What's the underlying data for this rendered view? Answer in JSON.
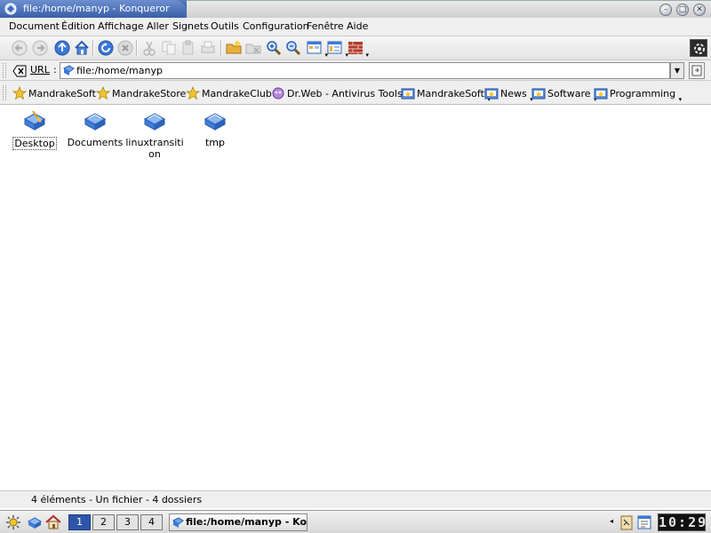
{
  "window": {
    "title": "file:/home/manyp - Konqueror"
  },
  "menubar": {
    "items": [
      {
        "label": "Document",
        "u": "D"
      },
      {
        "label": "Édition",
        "u": "É"
      },
      {
        "label": "Affichage",
        "u": "A"
      },
      {
        "label": "Aller",
        "u": "A"
      },
      {
        "label": "Signets",
        "u": "S"
      },
      {
        "label": "Outils",
        "u": "O"
      },
      {
        "label": "Configuration",
        "u": "C"
      },
      {
        "label": "Fenêtre",
        "u": "n"
      },
      {
        "label": "Aide",
        "u": "A"
      }
    ]
  },
  "toolbar": {
    "icons": [
      "back-icon",
      "forward-icon",
      "up-icon",
      "home-icon",
      "reload-icon",
      "stop-icon",
      "cut-icon",
      "copy-icon",
      "paste-icon",
      "print-icon",
      "new-folder-icon",
      "delete-icon",
      "zoom-in-icon",
      "zoom-out-icon",
      "view-mode-icon",
      "view-mode-2-icon",
      "firewall-icon"
    ]
  },
  "location": {
    "label": "URL",
    "colon": ":",
    "value": "file:/home/manyp"
  },
  "bookmarks": [
    {
      "label": "MandrakeSoft",
      "type": "star"
    },
    {
      "label": "MandrakeStore",
      "type": "star"
    },
    {
      "label": "MandrakeClub",
      "type": "star"
    },
    {
      "label": "Dr.Web - Antivirus Tools",
      "type": "drweb"
    },
    {
      "label": "MandrakeSoft",
      "type": "folder"
    },
    {
      "label": "News",
      "type": "folder"
    },
    {
      "label": "Software",
      "type": "folder"
    },
    {
      "label": "Programming",
      "type": "folder"
    }
  ],
  "files": [
    {
      "line1": "Desktop",
      "line2": ""
    },
    {
      "line1": "Documents",
      "line2": ""
    },
    {
      "line1": "linuxtransiti",
      "line2": "on"
    },
    {
      "line1": "tmp",
      "line2": ""
    }
  ],
  "status": {
    "text": "4 éléments - Un fichier - 4 dossiers"
  },
  "taskbar": {
    "desktops": [
      "1",
      "2",
      "3",
      "4"
    ],
    "active_desktop": "1",
    "task_label": "file:/home/manyp - Konqueror",
    "clock": "10:29"
  },
  "colors": {
    "titlebar": "#3d63ad",
    "active_desktop": "#2e55a8",
    "folder_blue": "#3f7fd6"
  }
}
